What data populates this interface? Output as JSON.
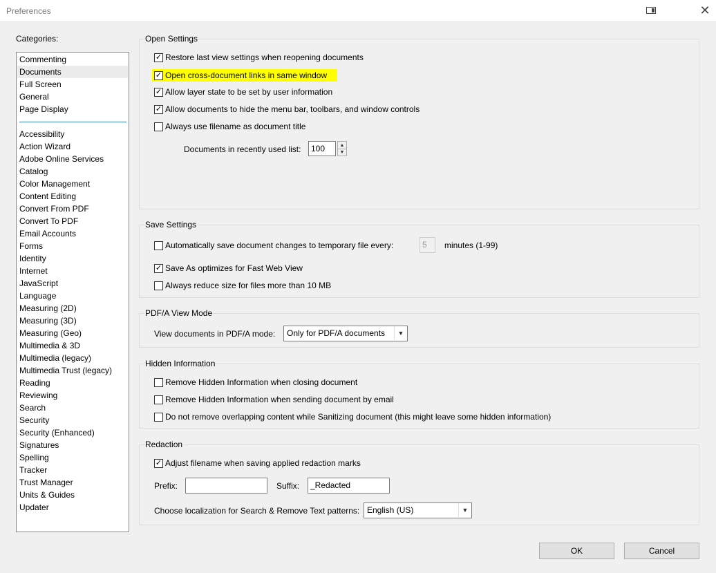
{
  "window": {
    "title": "Preferences"
  },
  "categories": {
    "label": "Categories:",
    "top_items": [
      "Commenting",
      "Documents",
      "Full Screen",
      "General",
      "Page Display"
    ],
    "selected": "Documents",
    "items": [
      "Accessibility",
      "Action Wizard",
      "Adobe Online Services",
      "Catalog",
      "Color Management",
      "Content Editing",
      "Convert From PDF",
      "Convert To PDF",
      "Email Accounts",
      "Forms",
      "Identity",
      "Internet",
      "JavaScript",
      "Language",
      "Measuring (2D)",
      "Measuring (3D)",
      "Measuring (Geo)",
      "Multimedia & 3D",
      "Multimedia (legacy)",
      "Multimedia Trust (legacy)",
      "Reading",
      "Reviewing",
      "Search",
      "Security",
      "Security (Enhanced)",
      "Signatures",
      "Spelling",
      "Tracker",
      "Trust Manager",
      "Units & Guides",
      "Updater"
    ]
  },
  "open_settings": {
    "title": "Open Settings",
    "checks": [
      {
        "label": "Restore last view settings when reopening documents",
        "checked": true
      },
      {
        "label": "Open cross-document links in same window",
        "checked": true,
        "highlighted": true
      },
      {
        "label": "Allow layer state to be set by user information",
        "checked": true
      },
      {
        "label": "Allow documents to hide the menu bar, toolbars, and window controls",
        "checked": true
      },
      {
        "label": "Always use filename as document title",
        "checked": false
      }
    ],
    "recent_label": "Documents in recently used list:",
    "recent_value": "100"
  },
  "save_settings": {
    "title": "Save Settings",
    "autosave_label": "Automatically save document changes to temporary file every:",
    "autosave_checked": false,
    "autosave_value": "5",
    "autosave_unit": "minutes (1-99)",
    "fastweb_label": "Save As optimizes for Fast Web View",
    "fastweb_checked": true,
    "reduce_label": "Always reduce size for files more than 10 MB",
    "reduce_checked": false
  },
  "pdfa": {
    "title": "PDF/A View Mode",
    "label": "View documents in PDF/A mode:",
    "value": "Only for PDF/A documents"
  },
  "hidden_info": {
    "title": "Hidden Information",
    "checks": [
      {
        "label": "Remove Hidden Information when closing document",
        "checked": false
      },
      {
        "label": "Remove Hidden Information when sending document by email",
        "checked": false
      },
      {
        "label": "Do not remove overlapping content while Sanitizing document (this might leave some hidden information)",
        "checked": false
      }
    ]
  },
  "redaction": {
    "title": "Redaction",
    "adjust_label": "Adjust filename when saving applied redaction marks",
    "adjust_checked": true,
    "prefix_label": "Prefix:",
    "prefix_value": "",
    "suffix_label": "Suffix:",
    "suffix_value": "_Redacted",
    "locale_label": "Choose localization for Search & Remove Text patterns:",
    "locale_value": "English (US)"
  },
  "buttons": {
    "ok": "OK",
    "cancel": "Cancel"
  }
}
